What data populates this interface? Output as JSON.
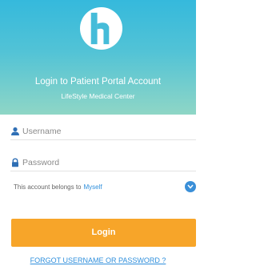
{
  "header": {
    "title": "Login to Patient Portal Account",
    "subtitle": "LifeStyle Medical Center",
    "logo_icon": "hospital-h-logo"
  },
  "form": {
    "username_placeholder": "Username",
    "password_placeholder": "Password",
    "username_icon": "user-icon",
    "password_icon": "lock-icon",
    "belongs_label": "This account belongs to",
    "belongs_value": "Myself",
    "login_label": "Login",
    "forgot_label": "FORGOT USERNAME OR PASSWORD ?"
  },
  "colors": {
    "accent": "#f7a529",
    "link": "#2f8fdc",
    "hero_top": "#35b9dc",
    "hero_bottom": "#8fd6c6"
  }
}
